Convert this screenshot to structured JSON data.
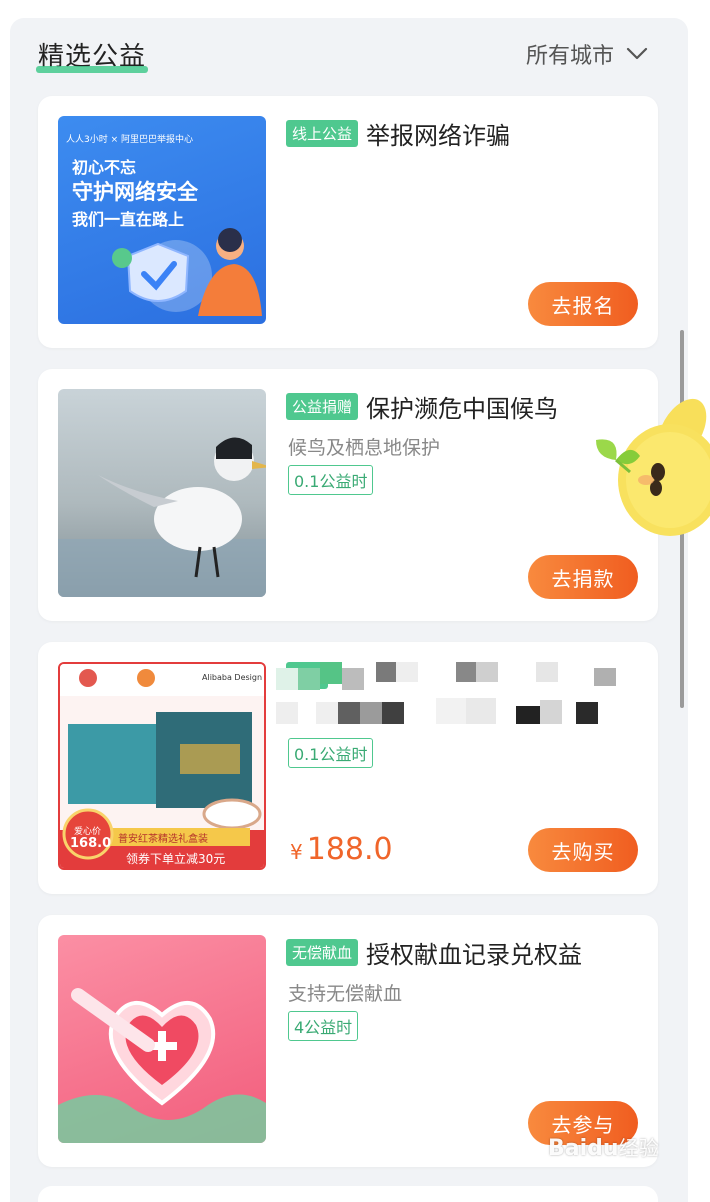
{
  "header": {
    "title": "精选公益",
    "city_filter": "所有城市"
  },
  "cards": [
    {
      "tag": "线上公益",
      "title": "举报网络诈骗",
      "cta": "去报名",
      "image": {
        "top_logos": "人人3小时 × 阿里巴巴举报中心",
        "line1": "初心不忘",
        "line2": "守护网络安全",
        "line3": "我们一直在路上"
      }
    },
    {
      "tag": "公益捐赠",
      "title": "保护濒危中国候鸟",
      "subtitle": "候鸟及栖息地保护",
      "hours": "0.1公益时",
      "cta": "去捐款"
    },
    {
      "tag": "善匠",
      "hours": "0.1公益时",
      "price_symbol": "¥",
      "price": "188.0",
      "cta": "去购买",
      "image": {
        "brand_text": "Alibaba Design",
        "badge_label": "爱心价",
        "badge_price": "168.0",
        "product_name": "普安红茶精选礼盒装",
        "promo": "领券下单立减30元"
      }
    },
    {
      "tag": "无偿献血",
      "title": "授权献血记录兑权益",
      "subtitle": "支持无偿献血",
      "hours": "4公益时",
      "cta": "去参与"
    }
  ],
  "watermark": {
    "brand": "Baidu",
    "sub": "经验"
  },
  "colors": {
    "accent_green": "#4fc88f",
    "cta_orange": "#f05d20",
    "price_orange": "#f0652a"
  }
}
